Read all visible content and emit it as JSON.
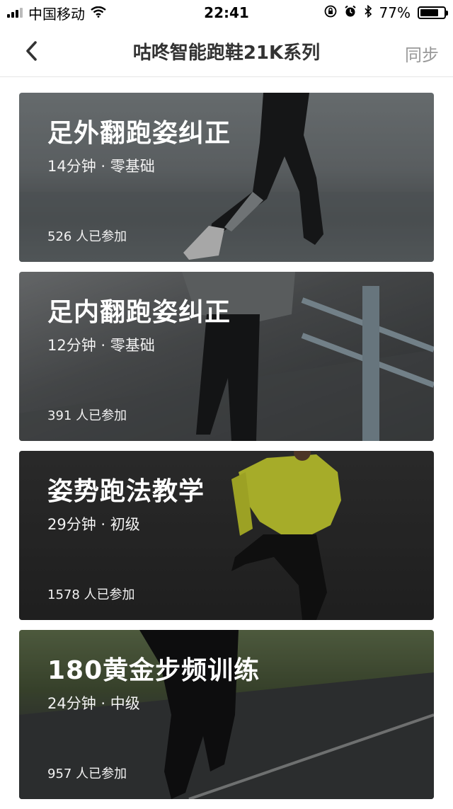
{
  "status_bar": {
    "carrier": "中国移动",
    "time": "22:41",
    "battery_percent": "77%",
    "battery_level": 0.77,
    "icons": [
      "signal-icon",
      "wifi-icon",
      "orientation-lock-icon",
      "alarm-icon",
      "bluetooth-icon",
      "battery-icon"
    ]
  },
  "nav": {
    "back_icon": "chevron-left-icon",
    "title": "咕咚智能跑鞋21K系列",
    "action_label": "同步"
  },
  "courses": [
    {
      "title": "足外翻跑姿纠正",
      "meta": "14分钟 · 零基础",
      "participants": "526 人已参加"
    },
    {
      "title": "足内翻跑姿纠正",
      "meta": "12分钟 · 零基础",
      "participants": "391 人已参加"
    },
    {
      "title": "姿势跑法教学",
      "meta": "29分钟 · 初级",
      "participants": "1578 人已参加"
    },
    {
      "title": "180黄金步频训练",
      "meta": "24分钟 · 中级",
      "participants": "957 人已参加"
    }
  ],
  "colors": {
    "nav_title": "#333333",
    "nav_action": "#999999",
    "card_text": "#ffffff",
    "jacket_accent": "#e6ef3a"
  }
}
